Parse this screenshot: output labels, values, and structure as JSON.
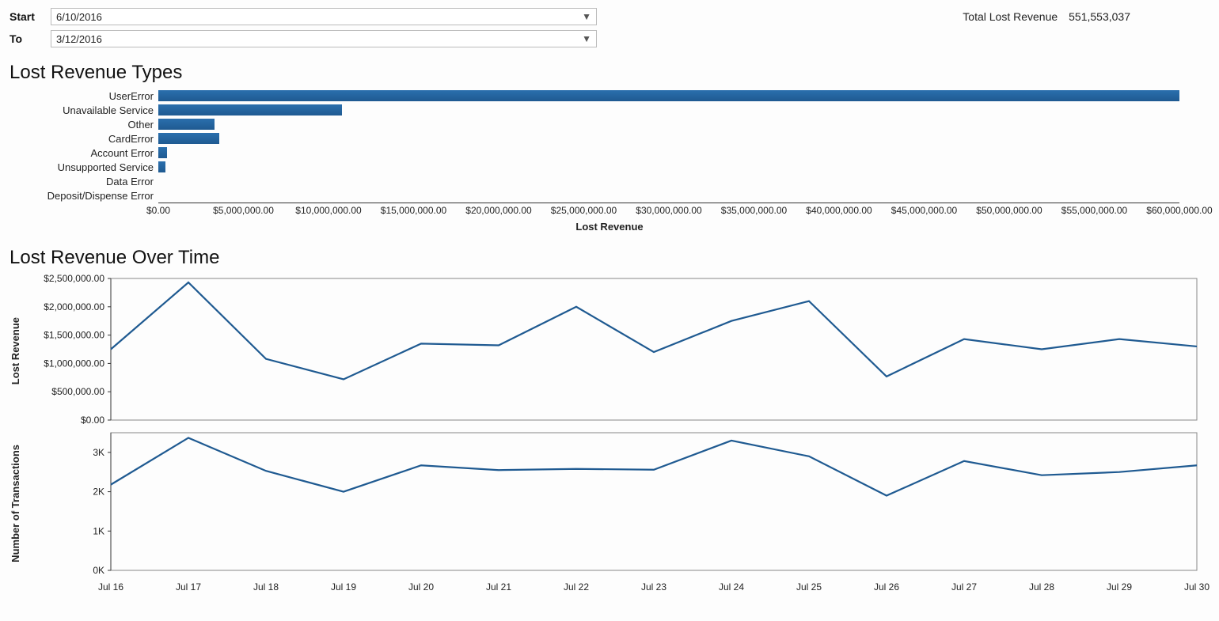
{
  "filters": {
    "start_label": "Start",
    "start_value": "6/10/2016",
    "to_label": "To",
    "to_value": "3/12/2016"
  },
  "kpi": {
    "label": "Total Lost Revenue",
    "value": "551,553,037"
  },
  "section_titles": {
    "types": "Lost Revenue Types",
    "over_time": "Lost Revenue Over Time"
  },
  "axis_titles": {
    "bar_x": "Lost Revenue",
    "line1_y": "Lost Revenue",
    "line2_y": "Number of Transactions"
  },
  "chart_data": [
    {
      "id": "lost_revenue_types",
      "type": "bar",
      "orientation": "horizontal",
      "categories": [
        "UserError",
        "Unavailable Service",
        "Other",
        "CardError",
        "Account Error",
        "Unsupported Service",
        "Data Error",
        "Deposit/Dispense Error"
      ],
      "values": [
        60000000,
        10800000,
        3300000,
        3600000,
        500000,
        400000,
        0,
        0
      ],
      "xlabel": "Lost Revenue",
      "xlim": [
        0,
        60000000
      ],
      "xticks": [
        0,
        5000000,
        10000000,
        15000000,
        20000000,
        25000000,
        30000000,
        35000000,
        40000000,
        45000000,
        50000000,
        55000000,
        60000000
      ],
      "xtick_labels": [
        "$0.00",
        "$5,000,000.00",
        "$10,000,000.00",
        "$15,000,000.00",
        "$20,000,000.00",
        "$25,000,000.00",
        "$30,000,000.00",
        "$35,000,000.00",
        "$40,000,000.00",
        "$45,000,000.00",
        "$50,000,000.00",
        "$55,000,000.00",
        "$60,000,000.00"
      ]
    },
    {
      "id": "lost_revenue_over_time",
      "type": "line",
      "x_labels": [
        "Jul 16",
        "Jul 17",
        "Jul 18",
        "Jul 19",
        "Jul 20",
        "Jul 21",
        "Jul 22",
        "Jul 23",
        "Jul 24",
        "Jul 25",
        "Jul 26",
        "Jul 27",
        "Jul 28",
        "Jul 29",
        "Jul 30"
      ],
      "ylabel": "Lost Revenue",
      "ylim": [
        0,
        2500000
      ],
      "yticks": [
        0,
        500000,
        1000000,
        1500000,
        2000000,
        2500000
      ],
      "ytick_labels": [
        "$0.00",
        "$500,000.00",
        "$1,000,000.00",
        "$1,500,000.00",
        "$2,000,000.00",
        "$2,500,000.00"
      ],
      "values": [
        1250000,
        2430000,
        1080000,
        720000,
        1350000,
        1320000,
        2000000,
        1200000,
        1750000,
        2100000,
        770000,
        1430000,
        1250000,
        1430000,
        1300000
      ]
    },
    {
      "id": "transactions_over_time",
      "type": "line",
      "x_labels": [
        "Jul 16",
        "Jul 17",
        "Jul 18",
        "Jul 19",
        "Jul 20",
        "Jul 21",
        "Jul 22",
        "Jul 23",
        "Jul 24",
        "Jul 25",
        "Jul 26",
        "Jul 27",
        "Jul 28",
        "Jul 29",
        "Jul 30"
      ],
      "ylabel": "Number of Transactions",
      "ylim": [
        0,
        3500
      ],
      "yticks": [
        0,
        1000,
        2000,
        3000
      ],
      "ytick_labels": [
        "0K",
        "1K",
        "2K",
        "3K"
      ],
      "values": [
        2180,
        3370,
        2530,
        2000,
        2670,
        2550,
        2580,
        2560,
        3300,
        2900,
        1900,
        2780,
        2420,
        2500,
        2670
      ]
    }
  ]
}
